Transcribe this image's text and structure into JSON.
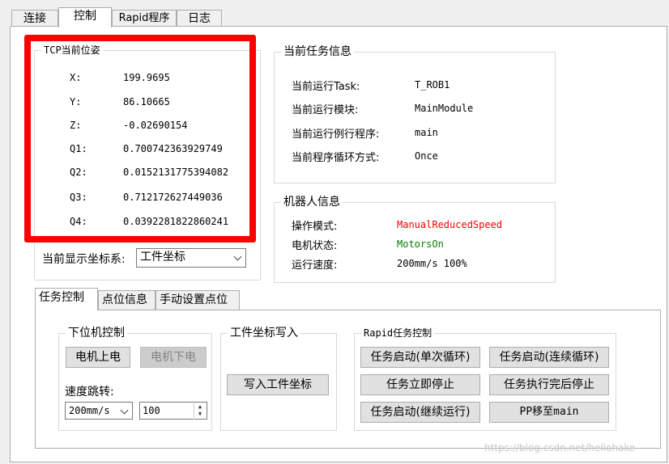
{
  "tabs": [
    "连接",
    "控制",
    "Rapid程序",
    "日志"
  ],
  "tcp": {
    "title": "TCP当前位姿",
    "rows": [
      {
        "label": "X:",
        "value": "199.9695"
      },
      {
        "label": "Y:",
        "value": "86.10665"
      },
      {
        "label": "Z:",
        "value": "-0.02690154"
      },
      {
        "label": "Q1:",
        "value": "0.700742363929749"
      },
      {
        "label": "Q2:",
        "value": "0.0152131775394082"
      },
      {
        "label": "Q3:",
        "value": "0.712172627449036"
      },
      {
        "label": "Q4:",
        "value": "0.0392281822860241"
      }
    ]
  },
  "coord": {
    "label": "当前显示坐标系:",
    "selected": "工件坐标"
  },
  "task": {
    "title": "当前任务信息",
    "rows": [
      {
        "label": "当前运行Task:",
        "value": "T_ROB1"
      },
      {
        "label": "当前运行模块:",
        "value": "MainModule"
      },
      {
        "label": "当前运行例行程序:",
        "value": "main"
      },
      {
        "label": "当前程序循环方式:",
        "value": "Once"
      }
    ]
  },
  "robot": {
    "title": "机器人信息",
    "rows": [
      {
        "label": "操作模式:",
        "value": "ManualReducedSpeed",
        "color": "#ff0000"
      },
      {
        "label": "电机状态:",
        "value": "MotorsOn",
        "color": "#008000"
      },
      {
        "label": "运行速度:",
        "value": "200mm/s 100%",
        "color": "#000000"
      }
    ]
  },
  "subtabs": [
    "任务控制",
    "点位信息",
    "手动设置点位"
  ],
  "lower": {
    "title": "下位机控制",
    "motor_on": "电机上电",
    "motor_off": "电机下电",
    "speed_label": "速度跳转:",
    "speed_select": "200mm/s",
    "speed_value": "100"
  },
  "workobj": {
    "title": "工件坐标写入",
    "write_button": "写入工件坐标"
  },
  "rapid": {
    "title": "Rapid任务控制",
    "buttons": [
      "任务启动(单次循环)",
      "任务启动(连续循环)",
      "任务立即停止",
      "任务执行完后停止",
      "任务启动(继续运行)",
      "PP移至main"
    ]
  },
  "watermark": "https://blog.csdn.net/hellohake"
}
